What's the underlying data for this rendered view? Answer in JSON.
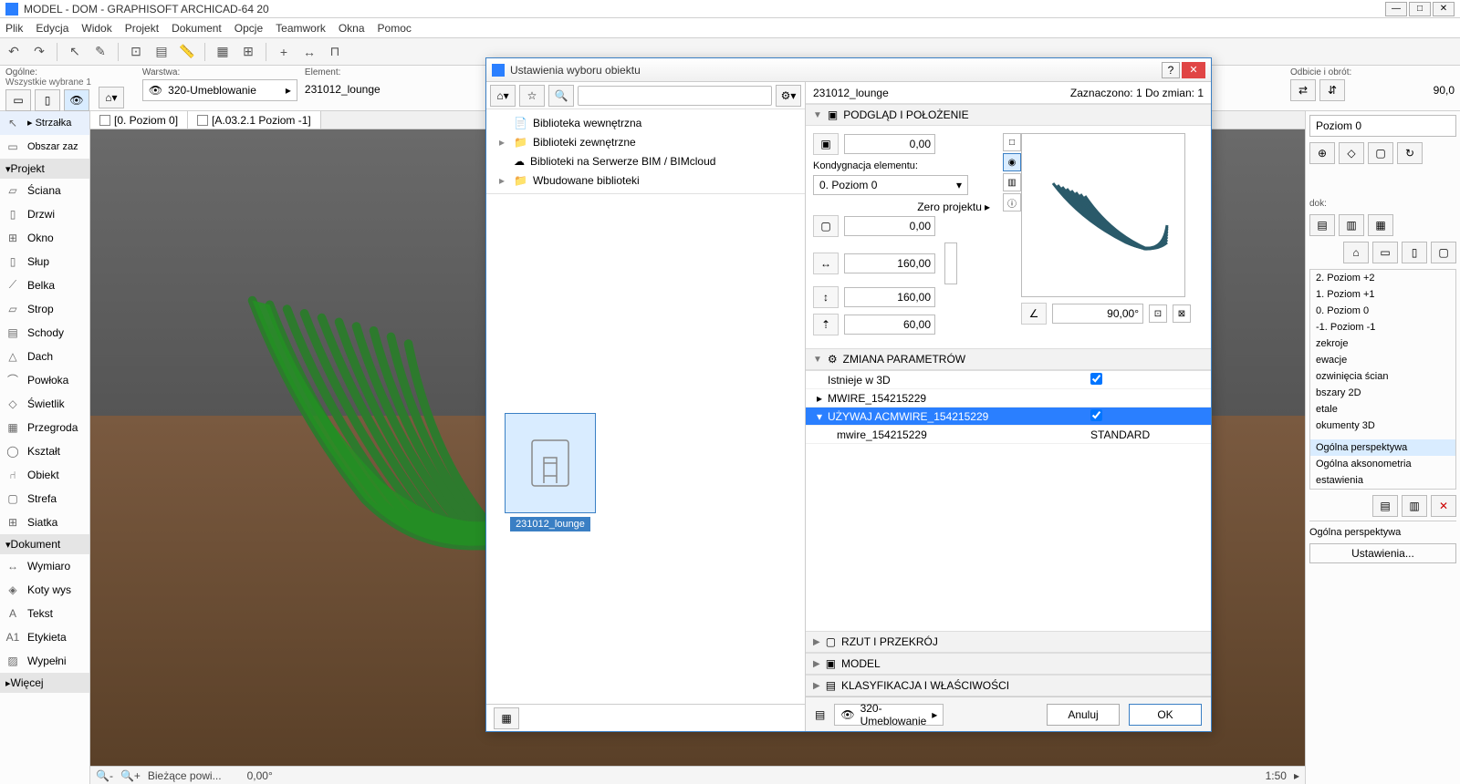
{
  "titlebar": {
    "title": "MODEL - DOM - GRAPHISOFT ARCHICAD-64 20"
  },
  "menus": [
    "Plik",
    "Edycja",
    "Widok",
    "Projekt",
    "Dokument",
    "Opcje",
    "Teamwork",
    "Okna",
    "Pomoc"
  ],
  "info_row": {
    "ogolne_label": "Ogólne:",
    "ogolne_sub": "Wszystkie wybrane 1",
    "warstwa_label": "Warstwa:",
    "warstwa_value": "320-Umeblowanie",
    "element_label": "Element:",
    "element_value": "231012_lounge",
    "odbicie_label": "Odbicie i obrót:",
    "angle": "90,0"
  },
  "toolbox": {
    "header1": "▸ Strzałka",
    "obszar": "Obszar zaz",
    "projekt_header": "Projekt",
    "items": [
      "Ściana",
      "Drzwi",
      "Okno",
      "Słup",
      "Belka",
      "Strop",
      "Schody",
      "Dach",
      "Powłoka",
      "Świetlik",
      "Przegroda",
      "Kształt",
      "Obiekt",
      "Strefa",
      "Siatka"
    ],
    "dokument_header": "Dokument",
    "doc_items": [
      "Wymiaro",
      "Koty wys",
      "Tekst",
      "Etykieta",
      "Wypełni"
    ],
    "more": "Więcej"
  },
  "viewport": {
    "tab1": "[0. Poziom 0]",
    "tab2": "[A.03.2.1 Poziom -1]"
  },
  "status": {
    "field1": "Bieżące powi...",
    "angle": "0,00°",
    "scale": "1:50"
  },
  "dialog": {
    "title": "Ustawienia wyboru obiektu",
    "object_name": "231012_lounge",
    "selection_info": "Zaznaczono: 1 Do zmian: 1",
    "tree": [
      "Biblioteka wewnętrzna",
      "Biblioteki zewnętrzne",
      "Biblioteki na Serwerze BIM / BIMcloud",
      "Wbudowane biblioteki"
    ],
    "file_item": "231012_lounge",
    "sections": {
      "preview": "PODGLĄD I POŁOŻENIE",
      "params": "ZMIANA PARAMETRÓW",
      "rzut": "RZUT I PRZEKRÓJ",
      "model": "MODEL",
      "klas": "KLASYFIKACJA I WŁAŚCIWOŚCI"
    },
    "position": {
      "z1": "0,00",
      "story_label": "Kondygnacja elementu:",
      "story": "0. Poziom 0",
      "zero_label": "Zero projektu",
      "z2": "0,00",
      "width": "160,00",
      "depth": "160,00",
      "height": "60,00",
      "angle": "90,00°"
    },
    "params": {
      "row1_name": "Istnieje w 3D",
      "row2_name": "MWIRE_154215229",
      "row3_name": "UŻYWAJ ACMWIRE_154215229",
      "row4_name": "mwire_154215229",
      "row4_val": "STANDARD"
    },
    "footer": {
      "layer": "320-Umeblowanie",
      "cancel": "Anuluj",
      "ok": "OK"
    }
  },
  "right_panel": {
    "poziom_label": "Poziom 0",
    "dok_label": "dok:",
    "navigator": [
      "2. Poziom +2",
      "1. Poziom +1",
      "0. Poziom 0",
      "-1. Poziom -1",
      "zekroje",
      "ewacje",
      "ozwinięcia ścian",
      "bszary 2D",
      "etale",
      "okumenty 3D",
      "",
      "Ogólna perspektywa",
      "Ogólna aksonometria",
      "estawienia"
    ],
    "footer1": "Ogólna perspektywa",
    "footer2": "Ustawienia..."
  }
}
